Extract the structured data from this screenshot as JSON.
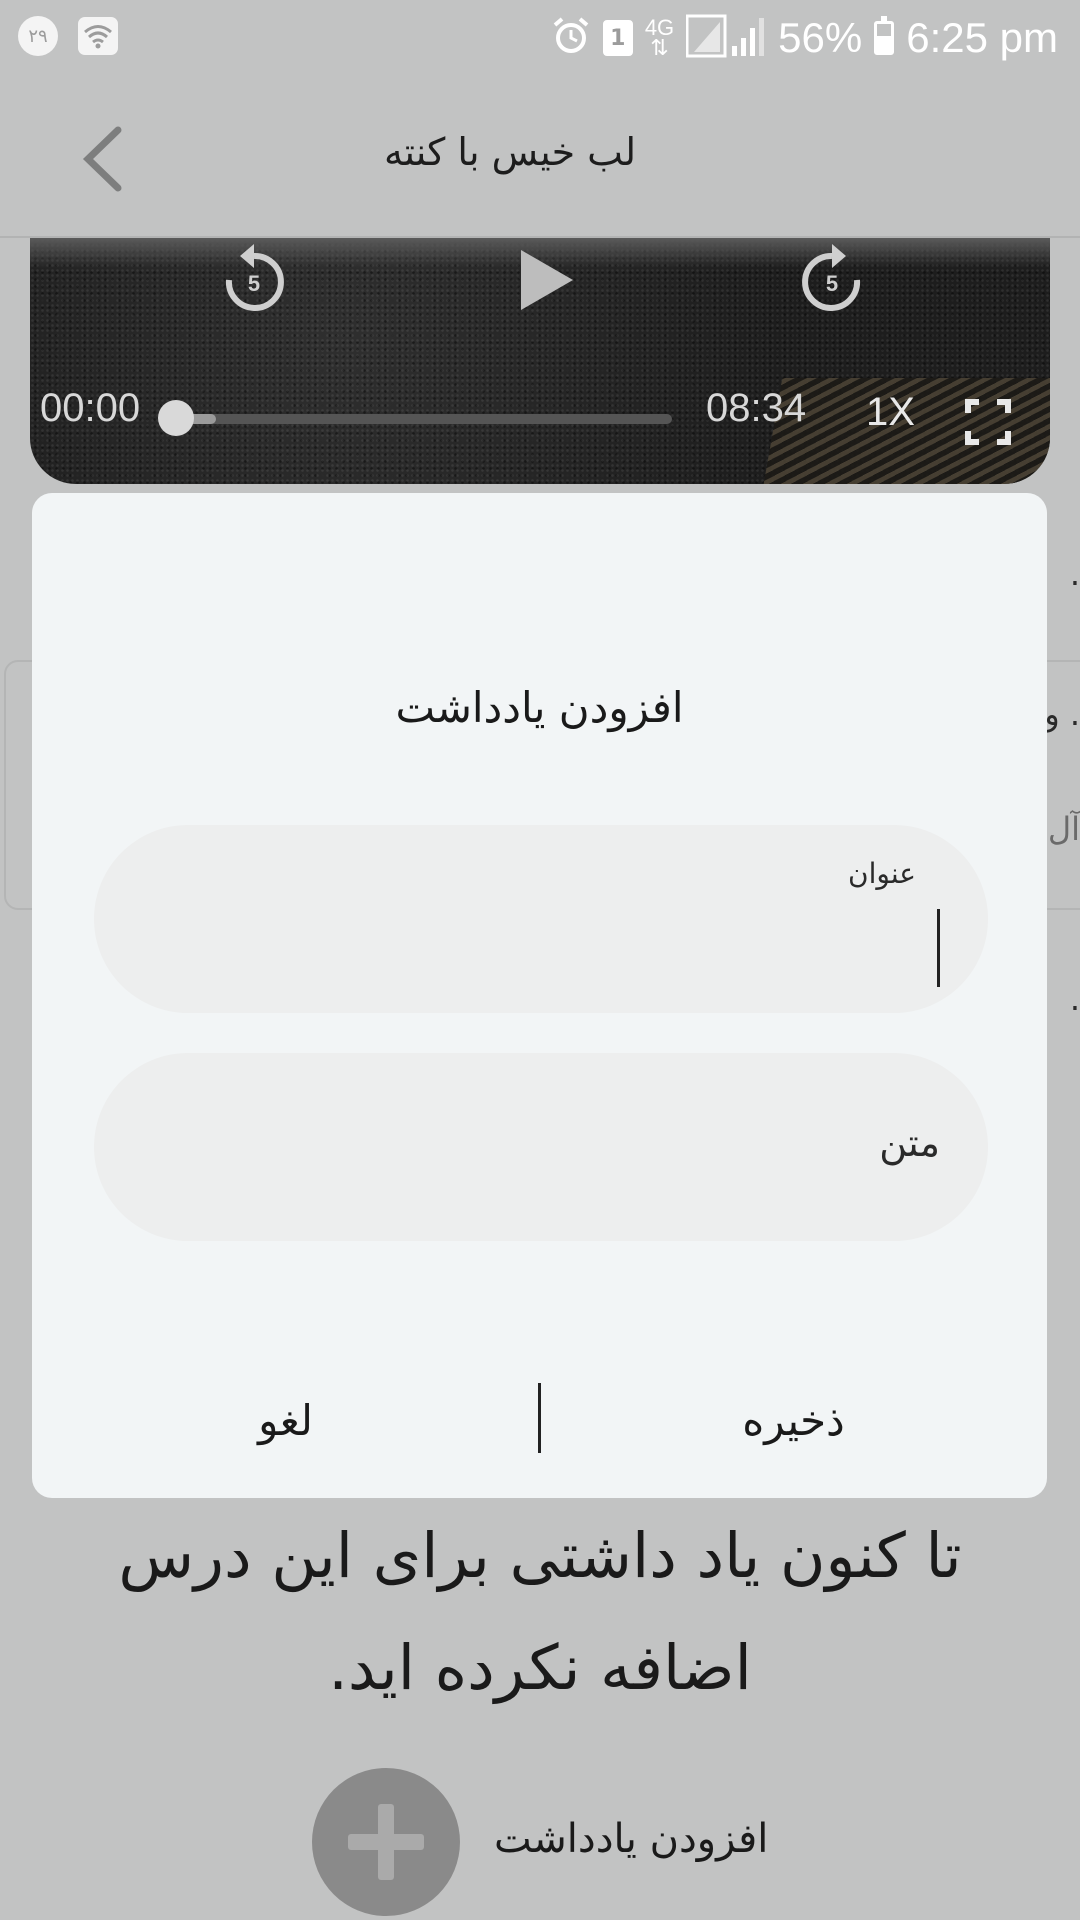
{
  "status_bar": {
    "notif_badge": "۲۹",
    "sim_slot": "1",
    "network": "4G",
    "battery": "56%",
    "battery_level": 0.56,
    "time": "6:25 pm",
    "icons": [
      "notification-badge-icon",
      "wifi-icon",
      "alarm-icon",
      "sim-icon",
      "4g-icon",
      "signal-icon",
      "battery-icon"
    ]
  },
  "app_bar": {
    "title": "لب خیس با کنته",
    "back_icon": "chevron-left-icon"
  },
  "video_player": {
    "current_time": "00:00",
    "duration": "08:34",
    "speed": "1X",
    "progress": 0.0,
    "buffered": 0.08,
    "rewind_seconds": "5",
    "forward_seconds": "5"
  },
  "background": {
    "empty_message": "تا کنون یاد داشتی برای این درس اضافه نکرده اید.",
    "add_note_label": "افزودن یادداشت"
  },
  "dialog": {
    "title": "افزودن یادداشت",
    "title_field_label": "عنوان",
    "title_field_value": "",
    "text_field_placeholder": "متن",
    "save_label": "ذخیره",
    "cancel_label": "لغو"
  }
}
